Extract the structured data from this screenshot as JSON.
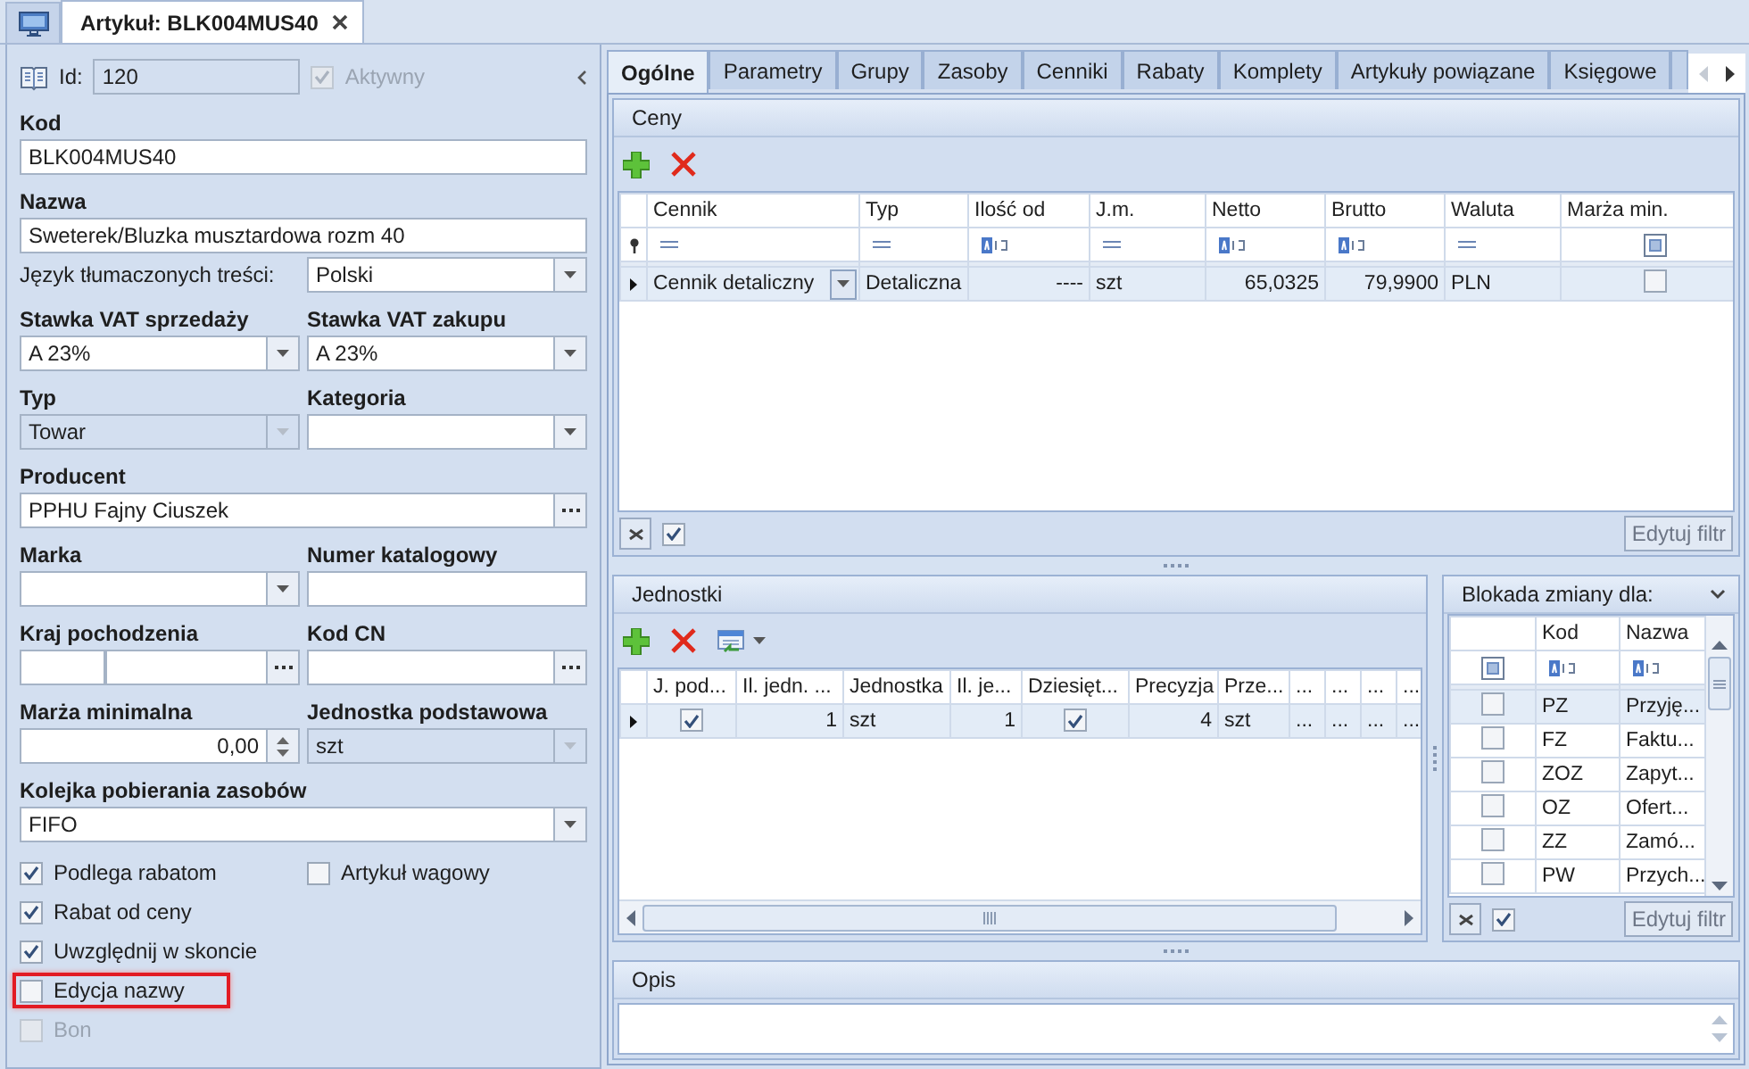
{
  "document_tabs": [
    {
      "label": "Artykuł: BLK004MUS40",
      "selected": true
    }
  ],
  "item_form": {
    "id": {
      "label": "Id:",
      "value": "120"
    },
    "active": {
      "label": "Aktywny",
      "checked": true,
      "disabled": true
    },
    "rows": [
      {
        "fields": [
          {
            "label": "Kod",
            "kind": "text",
            "value": "BLK004MUS40"
          }
        ]
      },
      {
        "fields": [
          {
            "label": "Nazwa",
            "kind": "text",
            "value": "Sweterek/Bluzka musztardowa rozm 40"
          }
        ]
      },
      {
        "fields": [
          {
            "label": "Język tłumaczonych treści:",
            "kind": "inline-combo",
            "value": "Polski"
          }
        ]
      },
      {
        "fields": [
          {
            "label": "Stawka VAT sprzedaży",
            "kind": "combo",
            "value": "A 23%"
          },
          {
            "label": "Stawka VAT zakupu",
            "kind": "combo",
            "value": "A 23%"
          }
        ]
      },
      {
        "fields": [
          {
            "label": "Typ",
            "kind": "combo",
            "value": "Towar",
            "disabled": true
          },
          {
            "label": "Kategoria",
            "kind": "combo"
          }
        ]
      },
      {
        "fields": [
          {
            "label": "Producent",
            "kind": "lookup",
            "value": "PPHU Fajny Ciuszek"
          }
        ]
      },
      {
        "fields": [
          {
            "label": "Marka",
            "kind": "combo"
          },
          {
            "label": "Numer katalogowy",
            "kind": "text"
          }
        ]
      },
      {
        "fields": [
          {
            "label": "Kraj pochodzenia",
            "kind": "pair-lookup"
          },
          {
            "label": "Kod CN",
            "kind": "lookup"
          }
        ]
      },
      {
        "fields": [
          {
            "label": "Marża minimalna",
            "kind": "spin",
            "value": "0,00"
          },
          {
            "label": "Jednostka podstawowa",
            "kind": "combo",
            "value": "szt",
            "disabled": true
          }
        ]
      },
      {
        "fields": [
          {
            "label": "Kolejka pobierania zasobów",
            "kind": "combo",
            "value": "FIFO"
          }
        ]
      }
    ],
    "checkbox_rows": [
      [
        {
          "label": "Podlega rabatom",
          "checked": true,
          "disabled": false,
          "highlighted": false
        },
        {
          "label": "Artykuł wagowy",
          "checked": false,
          "disabled": false,
          "highlighted": false
        }
      ],
      [
        {
          "label": "Rabat od ceny",
          "checked": true,
          "disabled": false,
          "highlighted": false
        }
      ],
      [
        {
          "label": "Uwzględnij w skoncie",
          "checked": true,
          "disabled": false,
          "highlighted": false
        }
      ],
      [
        {
          "label": "Edycja nazwy",
          "checked": false,
          "disabled": false,
          "highlighted": true
        }
      ],
      [
        {
          "label": "Bon",
          "checked": false,
          "disabled": true,
          "highlighted": false
        }
      ]
    ]
  },
  "detail_tabs": [
    {
      "label": "Ogólne",
      "selected": true
    },
    {
      "label": "Parametry",
      "selected": false
    },
    {
      "label": "Grupy",
      "selected": false
    },
    {
      "label": "Zasoby",
      "selected": false
    },
    {
      "label": "Cenniki",
      "selected": false
    },
    {
      "label": "Rabaty",
      "selected": false
    },
    {
      "label": "Komplety",
      "selected": false
    },
    {
      "label": "Artykuły powiązane",
      "selected": false
    },
    {
      "label": "Księgowe",
      "selected": false
    }
  ],
  "prices": {
    "title": "Ceny",
    "columns": [
      {
        "label": "Cennik",
        "kind": "combo"
      },
      {
        "label": "Typ",
        "kind": "text"
      },
      {
        "label": "Ilość od",
        "kind": "number"
      },
      {
        "label": "J.m.",
        "kind": "text"
      },
      {
        "label": "Netto",
        "kind": "number"
      },
      {
        "label": "Brutto",
        "kind": "number"
      },
      {
        "label": "Waluta",
        "kind": "text"
      },
      {
        "label": "Marża min.",
        "kind": "check"
      }
    ],
    "filter_row": [
      {
        "kind": "equals"
      },
      {
        "kind": "equals"
      },
      {
        "kind": "text"
      },
      {
        "kind": "equals"
      },
      {
        "kind": "text"
      },
      {
        "kind": "text"
      },
      {
        "kind": "equals"
      },
      {
        "kind": "check",
        "indeterminate": true
      }
    ],
    "rows": [
      {
        "selected": true,
        "cells": [
          "Cennik detaliczny",
          "Detaliczna",
          "----",
          "szt",
          "65,0325",
          "79,9900",
          "PLN",
          {
            "checked": false
          }
        ]
      }
    ],
    "footer": {
      "filter_enabled": true,
      "edit_filter": "Edytuj filtr"
    }
  },
  "units": {
    "title": "Jednostki",
    "columns": [
      {
        "label": "J. pod...",
        "kind": "check"
      },
      {
        "label": "Il. jedn. ...",
        "kind": "number"
      },
      {
        "label": "Jednostka",
        "kind": "text"
      },
      {
        "label": "Il. je...",
        "kind": "number"
      },
      {
        "label": "Dziesięt...",
        "kind": "check"
      },
      {
        "label": "Precyzja",
        "kind": "number"
      },
      {
        "label": "Prze...",
        "kind": "text"
      },
      {
        "label": "...",
        "kind": "text"
      },
      {
        "label": "...",
        "kind": "text"
      },
      {
        "label": "...",
        "kind": "text"
      },
      {
        "label": "...",
        "kind": "text"
      }
    ],
    "rows": [
      {
        "selected": true,
        "cells": [
          {
            "checked": true
          },
          "1",
          "szt",
          "1",
          {
            "checked": true
          },
          "4",
          "szt",
          "...",
          "...",
          "...",
          "..."
        ]
      }
    ]
  },
  "change_lock": {
    "title": "Blokada zmiany dla:",
    "columns": [
      {
        "kind": "check"
      },
      {
        "label": "Kod",
        "kind": "text"
      },
      {
        "label": "Nazwa",
        "kind": "text"
      }
    ],
    "filter_row": [
      {
        "kind": "check",
        "indeterminate": true
      },
      {
        "kind": "text"
      },
      {
        "kind": "text"
      }
    ],
    "rows": [
      {
        "selected": true,
        "cells": [
          {
            "checked": false
          },
          "PZ",
          "Przyję..."
        ]
      },
      {
        "selected": false,
        "cells": [
          {
            "checked": false
          },
          "FZ",
          "Faktu..."
        ]
      },
      {
        "selected": false,
        "cells": [
          {
            "checked": false
          },
          "ZOZ",
          "Zapyt..."
        ]
      },
      {
        "selected": false,
        "cells": [
          {
            "checked": false
          },
          "OZ",
          "Ofert..."
        ]
      },
      {
        "selected": false,
        "cells": [
          {
            "checked": false
          },
          "ZZ",
          "Zamó..."
        ]
      },
      {
        "selected": false,
        "cells": [
          {
            "checked": false
          },
          "PW",
          "Przych..."
        ]
      }
    ],
    "footer": {
      "filter_enabled": true,
      "edit_filter": "Edytuj filtr"
    }
  },
  "description": {
    "title": "Opis"
  }
}
